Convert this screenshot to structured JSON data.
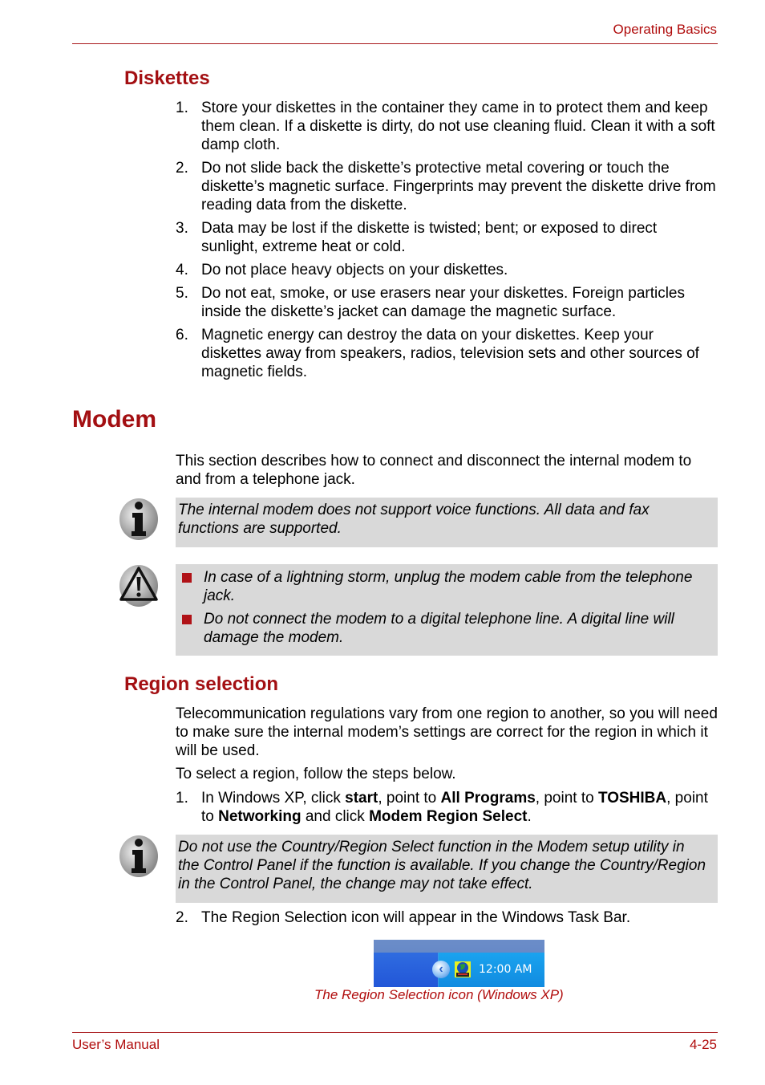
{
  "header": {
    "title": "Operating Basics"
  },
  "diskettes": {
    "heading": "Diskettes",
    "items": [
      {
        "num": "1.",
        "text": "Store your diskettes in the container they came in to protect them and keep them clean. If a diskette is dirty, do not use cleaning fluid. Clean it with a soft damp cloth."
      },
      {
        "num": "2.",
        "text": "Do not slide back the diskette’s protective metal covering or touch the diskette’s magnetic surface. Fingerprints may prevent the diskette drive from reading data from the diskette."
      },
      {
        "num": "3.",
        "text": "Data may be lost if the diskette is twisted; bent; or exposed to direct sunlight, extreme heat or cold."
      },
      {
        "num": "4.",
        "text": "Do not place heavy objects on your diskettes."
      },
      {
        "num": "5.",
        "text": "Do not eat, smoke, or use erasers near your diskettes. Foreign particles inside the diskette’s jacket can damage the magnetic surface."
      },
      {
        "num": "6.",
        "text": "Magnetic energy can destroy the data on your diskettes. Keep your diskettes away from speakers, radios, television sets and other sources of magnetic fields."
      }
    ]
  },
  "modem": {
    "heading": "Modem",
    "intro": "This section describes how to connect and disconnect the internal modem to and from a telephone jack.",
    "info_icon": "info-icon",
    "info_note": "The internal modem does not support voice functions. All data and fax functions are supported.",
    "warning_icon": "warning-icon",
    "warnings": [
      "In case of a lightning storm, unplug the modem cable from the telephone jack.",
      "Do not connect the modem to a digital telephone line. A digital line will damage the modem."
    ]
  },
  "region": {
    "heading": "Region selection",
    "para1": "Telecommunication regulations vary from one region to another, so you will need to make sure the internal modem’s settings are correct for the region in which it will be used.",
    "para2": "To select a region, follow the steps below.",
    "step1": {
      "num": "1.",
      "t1": "In Windows XP, click ",
      "b1": "start",
      "t2": ", point to ",
      "b2": "All Programs",
      "t3": ", point to ",
      "b3": "TOSHIBA",
      "t4": ", point to ",
      "b4": "Networking",
      "t5": " and click ",
      "b5": "Modem Region Select",
      "t6": "."
    },
    "info_note": "Do not use the Country/Region Select function in the Modem setup utility in the Control Panel if the function is available. If you change the Country/Region in the Control Panel, the change may not take effect.",
    "step2": {
      "num": "2.",
      "text": "The Region Selection icon will appear in the Windows Task Bar."
    },
    "taskbar": {
      "clock": "12:00 AM",
      "chevron": "‹"
    },
    "caption": "The Region Selection icon (Windows XP)"
  },
  "footer": {
    "left": "User’s Manual",
    "right": "4-25"
  }
}
